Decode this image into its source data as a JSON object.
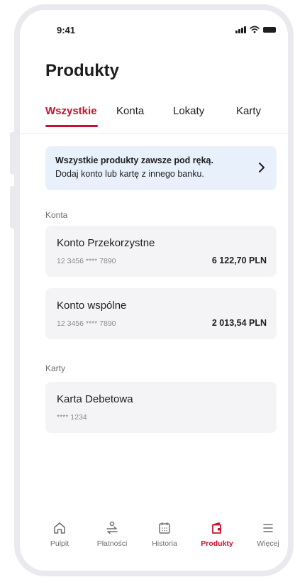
{
  "status_bar": {
    "time": "9:41"
  },
  "page": {
    "title": "Produkty"
  },
  "tabs": [
    {
      "label": "Wszystkie",
      "active": true
    },
    {
      "label": "Konta",
      "active": false
    },
    {
      "label": "Lokaty",
      "active": false
    },
    {
      "label": "Karty",
      "active": false
    }
  ],
  "banner": {
    "title": "Wszystkie produkty zawsze pod ręką.",
    "subtitle": "Dodaj konto lub kartę z innego banku."
  },
  "sections": {
    "accounts_label": "Konta",
    "cards_label": "Karty"
  },
  "accounts": [
    {
      "name": "Konto Przekorzystne",
      "number": "12 3456 **** 7890",
      "balance": "6 122,70 PLN"
    },
    {
      "name": "Konto wspólne",
      "number": "12 3456 **** 7890",
      "balance": "2 013,54 PLN"
    }
  ],
  "cards": [
    {
      "name": "Karta Debetowa",
      "number": "**** 1234"
    }
  ],
  "bottom_nav": [
    {
      "label": "Pulpit",
      "icon": "home-icon",
      "active": false
    },
    {
      "label": "Płatności",
      "icon": "payments-icon",
      "active": false
    },
    {
      "label": "Historia",
      "icon": "calendar-icon",
      "active": false
    },
    {
      "label": "Produkty",
      "icon": "wallet-icon",
      "active": true
    },
    {
      "label": "Więcej",
      "icon": "menu-icon",
      "active": false
    }
  ],
  "colors": {
    "accent": "#c8102e",
    "banner_bg": "#e8f1fb",
    "card_bg": "#f4f4f6"
  }
}
